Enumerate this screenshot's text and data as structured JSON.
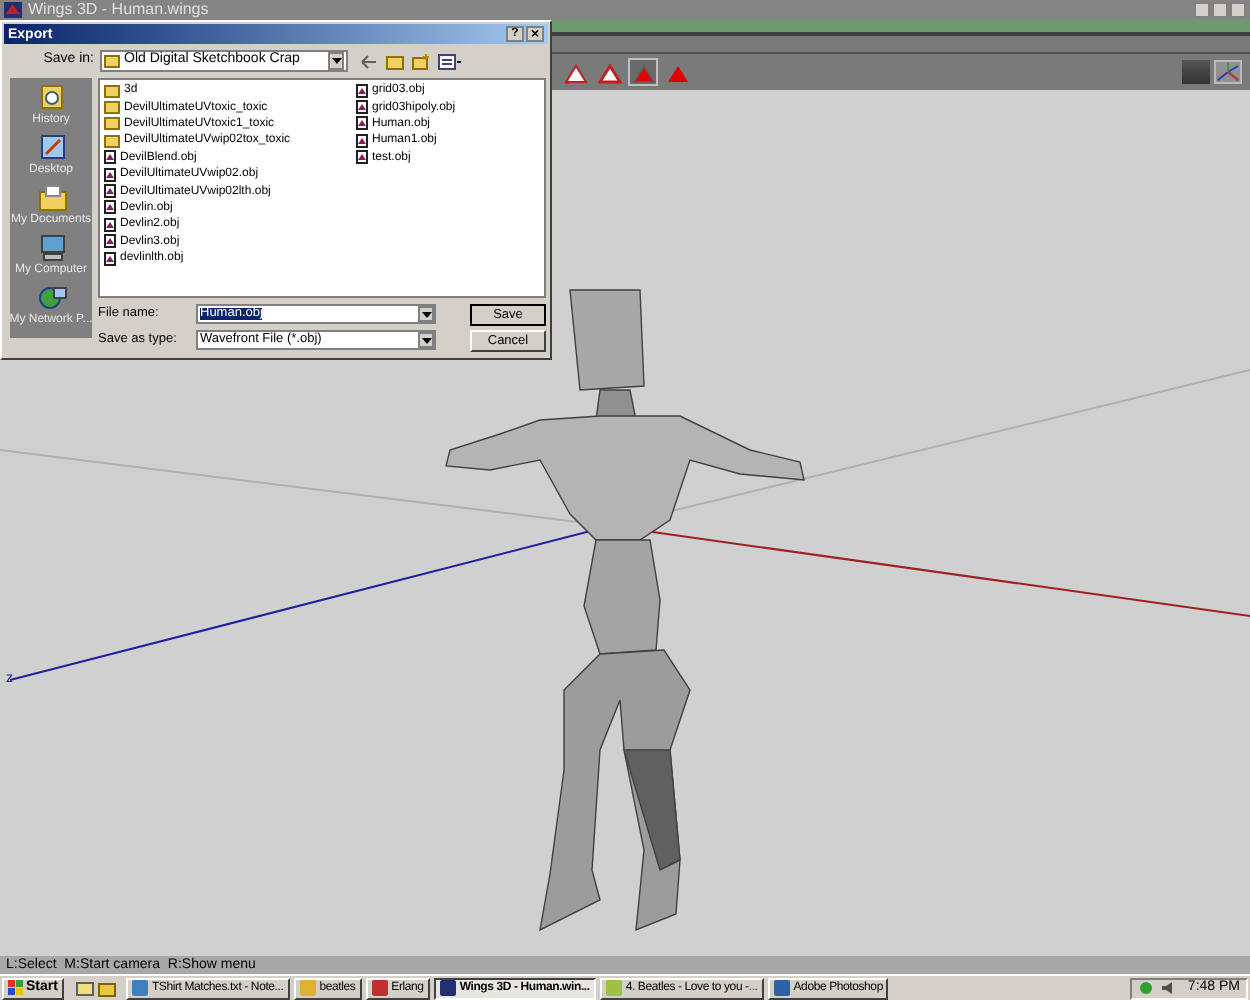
{
  "window": {
    "title": "Wings 3D - Human.wings"
  },
  "viewport": {
    "axis_label": "z"
  },
  "toolbar": {
    "modes": [
      {
        "selected": false
      },
      {
        "selected": false
      },
      {
        "selected": true
      },
      {
        "selected": false
      }
    ]
  },
  "dialog": {
    "title": "Export",
    "save_in_label": "Save in:",
    "save_in": "Old Digital Sketchbook Crap",
    "places": [
      "History",
      "Desktop",
      "My Documents",
      "My Computer",
      "My Network P..."
    ],
    "files": [
      {
        "name": "3d",
        "kind": "folder"
      },
      {
        "name": "DevilUltimateUVtoxic_toxic",
        "kind": "folder"
      },
      {
        "name": "DevilUltimateUVtoxic1_toxic",
        "kind": "folder"
      },
      {
        "name": "DevilUltimateUVwip02tox_toxic",
        "kind": "folder"
      },
      {
        "name": "DevilBlend.obj",
        "kind": "file"
      },
      {
        "name": "DevilUltimateUVwip02.obj",
        "kind": "file"
      },
      {
        "name": "DevilUltimateUVwip02lth.obj",
        "kind": "file"
      },
      {
        "name": "Devlin.obj",
        "kind": "file"
      },
      {
        "name": "Devlin2.obj",
        "kind": "file"
      },
      {
        "name": "Devlin3.obj",
        "kind": "file"
      },
      {
        "name": "devlinlth.obj",
        "kind": "file"
      },
      {
        "name": "grid03.obj",
        "kind": "file"
      },
      {
        "name": "grid03hipoly.obj",
        "kind": "file"
      },
      {
        "name": "Human.obj",
        "kind": "file"
      },
      {
        "name": "Human1.obj",
        "kind": "file"
      },
      {
        "name": "test.obj",
        "kind": "file"
      }
    ],
    "file_name_label": "File name:",
    "file_name": "Human.obj",
    "type_label": "Save as type:",
    "save_as_type": "Wavefront File (*.obj)",
    "buttons": [
      "Save",
      "Cancel"
    ],
    "help": "?",
    "close": "×"
  },
  "status_bar": "L:Select  M:Start camera  R:Show menu",
  "taskbar": {
    "start": "Start",
    "items": [
      {
        "label": "TShirt Matches.txt - Note...",
        "selected": false
      },
      {
        "label": "beatles",
        "selected": false
      },
      {
        "label": "Erlang",
        "selected": false
      },
      {
        "label": "Wings 3D - Human.win...",
        "selected": true
      },
      {
        "label": "4. Beatles - Love to you -...",
        "selected": false
      },
      {
        "label": "Adobe Photoshop",
        "selected": false
      }
    ],
    "clock": "7:48 PM"
  }
}
